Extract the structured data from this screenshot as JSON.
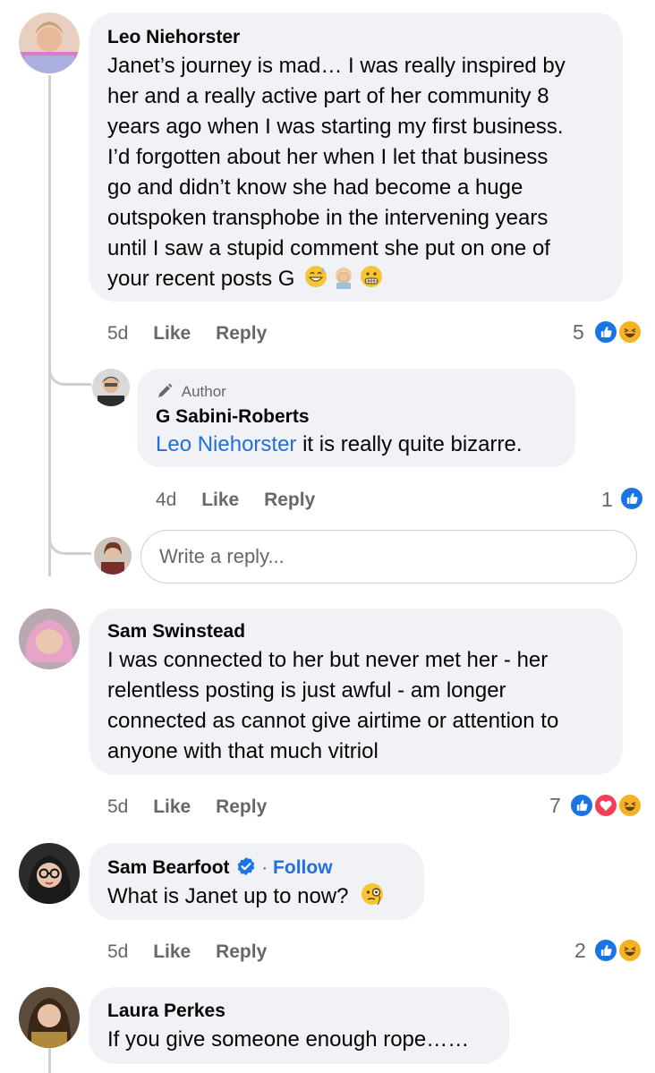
{
  "comments": [
    {
      "name": "Leo Niehorster",
      "lines": [
        "Janet’s journey is mad… I was really inspired by",
        "her and a really active part of her community 8",
        "years ago when I was starting my first business.",
        "I’d forgotten about her when I let that business",
        "go and didn’t know she had become a huge",
        "outspoken transphobe in the intervening years",
        "until I saw a stupid comment she put on one of",
        "your recent posts G"
      ],
      "emojis": [
        "grinning-sweat-emoji",
        "facepalm-emoji",
        "grimacing-emoji"
      ],
      "time": "5d",
      "like": "Like",
      "reply": "Reply",
      "reaction_count": "5",
      "reactions": [
        "like",
        "haha"
      ]
    },
    {
      "badge": "Author",
      "name": "G Sabini-Roberts",
      "mention": "Leo Niehorster",
      "text": " it is really quite bizarre.",
      "time": "4d",
      "like": "Like",
      "reply": "Reply",
      "reaction_count": "1",
      "reactions": [
        "like"
      ]
    },
    {
      "name": "Sam Swinstead",
      "lines": [
        "I was connected to her but never met her - her",
        "relentless posting is just awful -  am longer",
        "connected as cannot give airtime or attention to",
        "anyone with that much vitriol"
      ],
      "time": "5d",
      "like": "Like",
      "reply": "Reply",
      "reaction_count": "7",
      "reactions": [
        "like",
        "love",
        "haha"
      ]
    },
    {
      "name": "Sam Bearfoot",
      "verified": true,
      "follow": "Follow",
      "text": "What is Janet up to now?",
      "emojis": [
        "monocle-emoji"
      ],
      "time": "5d",
      "like": "Like",
      "reply": "Reply",
      "reaction_count": "2",
      "reactions": [
        "like",
        "haha"
      ]
    },
    {
      "name": "Laura Perkes",
      "text": "If you give someone enough rope……"
    }
  ],
  "reply_box": {
    "placeholder": "Write a reply..."
  },
  "colors": {
    "link": "#216fdb",
    "bubble": "#f0f2f5",
    "meta": "#65676b",
    "like": "#1b74e4",
    "love": "#f33e58",
    "haha": "#f7b125"
  }
}
